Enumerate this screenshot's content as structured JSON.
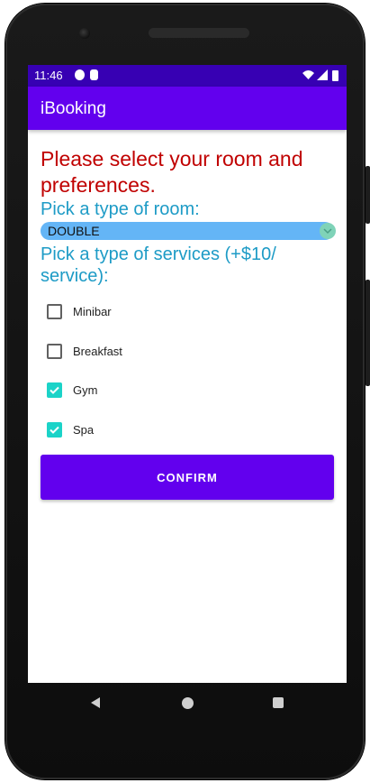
{
  "status_bar": {
    "time": "11:46",
    "notifications": [
      "generic-circle-icon",
      "sim-card-icon"
    ],
    "icons": [
      "wifi-icon",
      "signal-icon",
      "battery-icon"
    ]
  },
  "app_bar": {
    "title": "iBooking"
  },
  "form": {
    "headline": "Please select your room and preferences.",
    "room_label": "Pick a type of room:",
    "room_selected": "DOUBLE",
    "services_label": "Pick a type of services (+$10/ service):",
    "services": [
      {
        "label": "Minibar",
        "checked": false
      },
      {
        "label": "Breakfast",
        "checked": false
      },
      {
        "label": "Gym",
        "checked": true
      },
      {
        "label": "Spa",
        "checked": true
      }
    ],
    "confirm_label": "CONFIRM"
  },
  "colors": {
    "status_bar": "#3700b3",
    "app_bar": "#6200ee",
    "headline": "#c00000",
    "section_label": "#1d9bc6",
    "spinner": "#64b5f6",
    "checkbox_checked": "#1bd3c8"
  },
  "navigation": {
    "buttons": [
      "back-icon",
      "home-icon",
      "recents-icon"
    ]
  }
}
